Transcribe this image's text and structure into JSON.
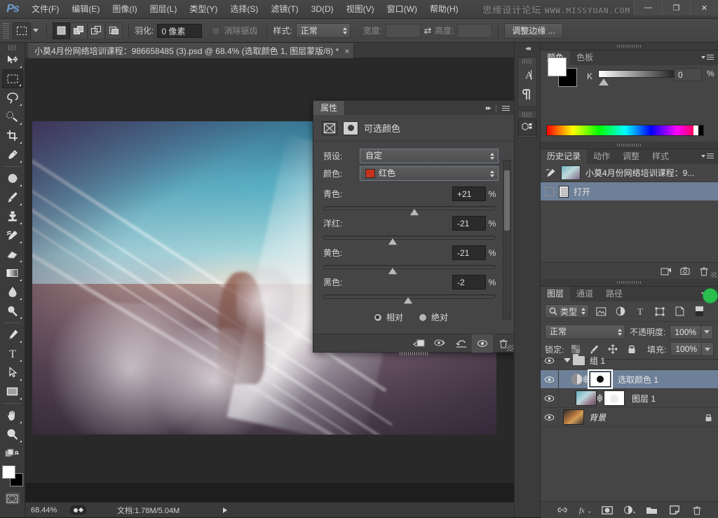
{
  "app": {
    "logo": "Ps",
    "watermark_text": "思缘设计论坛",
    "watermark_url": "WWW.MISSYUAN.COM",
    "win_minimize": "—",
    "win_restore": "❐",
    "win_close": "✕"
  },
  "menubar": {
    "items": [
      {
        "label": "文件(F)"
      },
      {
        "label": "编辑(E)"
      },
      {
        "label": "图像(I)"
      },
      {
        "label": "图层(L)"
      },
      {
        "label": "类型(Y)"
      },
      {
        "label": "选择(S)"
      },
      {
        "label": "滤镜(T)"
      },
      {
        "label": "3D(D)"
      },
      {
        "label": "视图(V)"
      },
      {
        "label": "窗口(W)"
      },
      {
        "label": "帮助(H)"
      }
    ]
  },
  "optionsbar": {
    "feather_label": "羽化:",
    "feather_value": "0 像素",
    "antialias_label": "消除锯齿",
    "style_label": "样式:",
    "style_value": "正常",
    "width_label": "宽度:",
    "width_value": "",
    "height_label": "高度:",
    "height_value": "",
    "refine_edge_label": "调整边缘 ..."
  },
  "document": {
    "tab_title": "小莫4月份网络培训课程：986658485 (3).psd @ 68.4% (选取颜色 1, 图层蒙版/8) *",
    "tab_close": "×"
  },
  "properties": {
    "tab_label": "属性",
    "title": "可选颜色",
    "preset_label": "预设:",
    "preset_value": "自定",
    "color_label": "颜色:",
    "color_value": "红色",
    "color_swatch": "#c6321c",
    "sliders": [
      {
        "label": "青色:",
        "value": "+21",
        "unit": "%",
        "pos": 53
      },
      {
        "label": "洋红:",
        "value": "-21",
        "unit": "%",
        "pos": 40
      },
      {
        "label": "黄色:",
        "value": "-21",
        "unit": "%",
        "pos": 40
      },
      {
        "label": "黑色:",
        "value": "-2",
        "unit": "%",
        "pos": 49
      }
    ],
    "method_relative": "相对",
    "method_absolute": "绝对",
    "method_selected": "相对"
  },
  "color_panel": {
    "tabs": [
      {
        "label": "颜色",
        "active": true
      },
      {
        "label": "色板",
        "active": false
      }
    ],
    "channel_label": "K",
    "channel_value": "0",
    "channel_unit": "%",
    "foreground": "#ffffff",
    "background": "#000000"
  },
  "history_panel": {
    "tabs": [
      {
        "label": "历史记录",
        "active": true
      },
      {
        "label": "动作",
        "active": false
      },
      {
        "label": "调整",
        "active": false
      },
      {
        "label": "样式",
        "active": false
      }
    ],
    "snapshot_label": "小莫4月份网络培训课程：9...",
    "states": [
      {
        "label": "打开",
        "selected": true
      }
    ]
  },
  "layers_panel": {
    "tabs": [
      {
        "label": "图层",
        "active": true
      },
      {
        "label": "通道",
        "active": false
      },
      {
        "label": "路径",
        "active": false
      }
    ],
    "filter_kind": "类型",
    "blend_mode": "正常",
    "opacity_label": "不透明度:",
    "opacity_value": "100%",
    "lock_label": "锁定:",
    "fill_label": "填充:",
    "fill_value": "100%",
    "layers": [
      {
        "name": "组 1",
        "type": "group",
        "visible": true,
        "selected": false
      },
      {
        "name": "选取颜色 1",
        "type": "adjustment",
        "visible": true,
        "selected": true,
        "linked": true,
        "mask_active": true
      },
      {
        "name": "图层 1",
        "type": "pixel",
        "visible": true,
        "selected": false,
        "linked": true
      },
      {
        "name": "背景",
        "type": "background",
        "visible": true,
        "selected": false,
        "locked": true
      }
    ]
  },
  "statusbar": {
    "zoom": "68.44%",
    "doc_info": "文档:1.78M/5.04M"
  },
  "toolbar": {
    "tools": [
      {
        "name": "move-tool",
        "active": false
      },
      {
        "name": "rectangular-marquee-tool",
        "active": true
      },
      {
        "name": "lasso-tool",
        "active": false
      },
      {
        "name": "quick-selection-tool",
        "active": false
      },
      {
        "name": "crop-tool",
        "active": false
      },
      {
        "name": "eyedropper-tool",
        "active": false
      },
      {
        "name": "spot-healing-brush-tool",
        "active": false
      },
      {
        "name": "brush-tool",
        "active": false
      },
      {
        "name": "clone-stamp-tool",
        "active": false
      },
      {
        "name": "history-brush-tool",
        "active": false
      },
      {
        "name": "eraser-tool",
        "active": false
      },
      {
        "name": "gradient-tool",
        "active": false
      },
      {
        "name": "blur-tool",
        "active": false
      },
      {
        "name": "dodge-tool",
        "active": false
      },
      {
        "name": "pen-tool",
        "active": false
      },
      {
        "name": "type-tool",
        "active": false
      },
      {
        "name": "path-selection-tool",
        "active": false
      },
      {
        "name": "rectangle-tool",
        "active": false
      },
      {
        "name": "hand-tool",
        "active": false
      },
      {
        "name": "zoom-tool",
        "active": false
      }
    ]
  }
}
